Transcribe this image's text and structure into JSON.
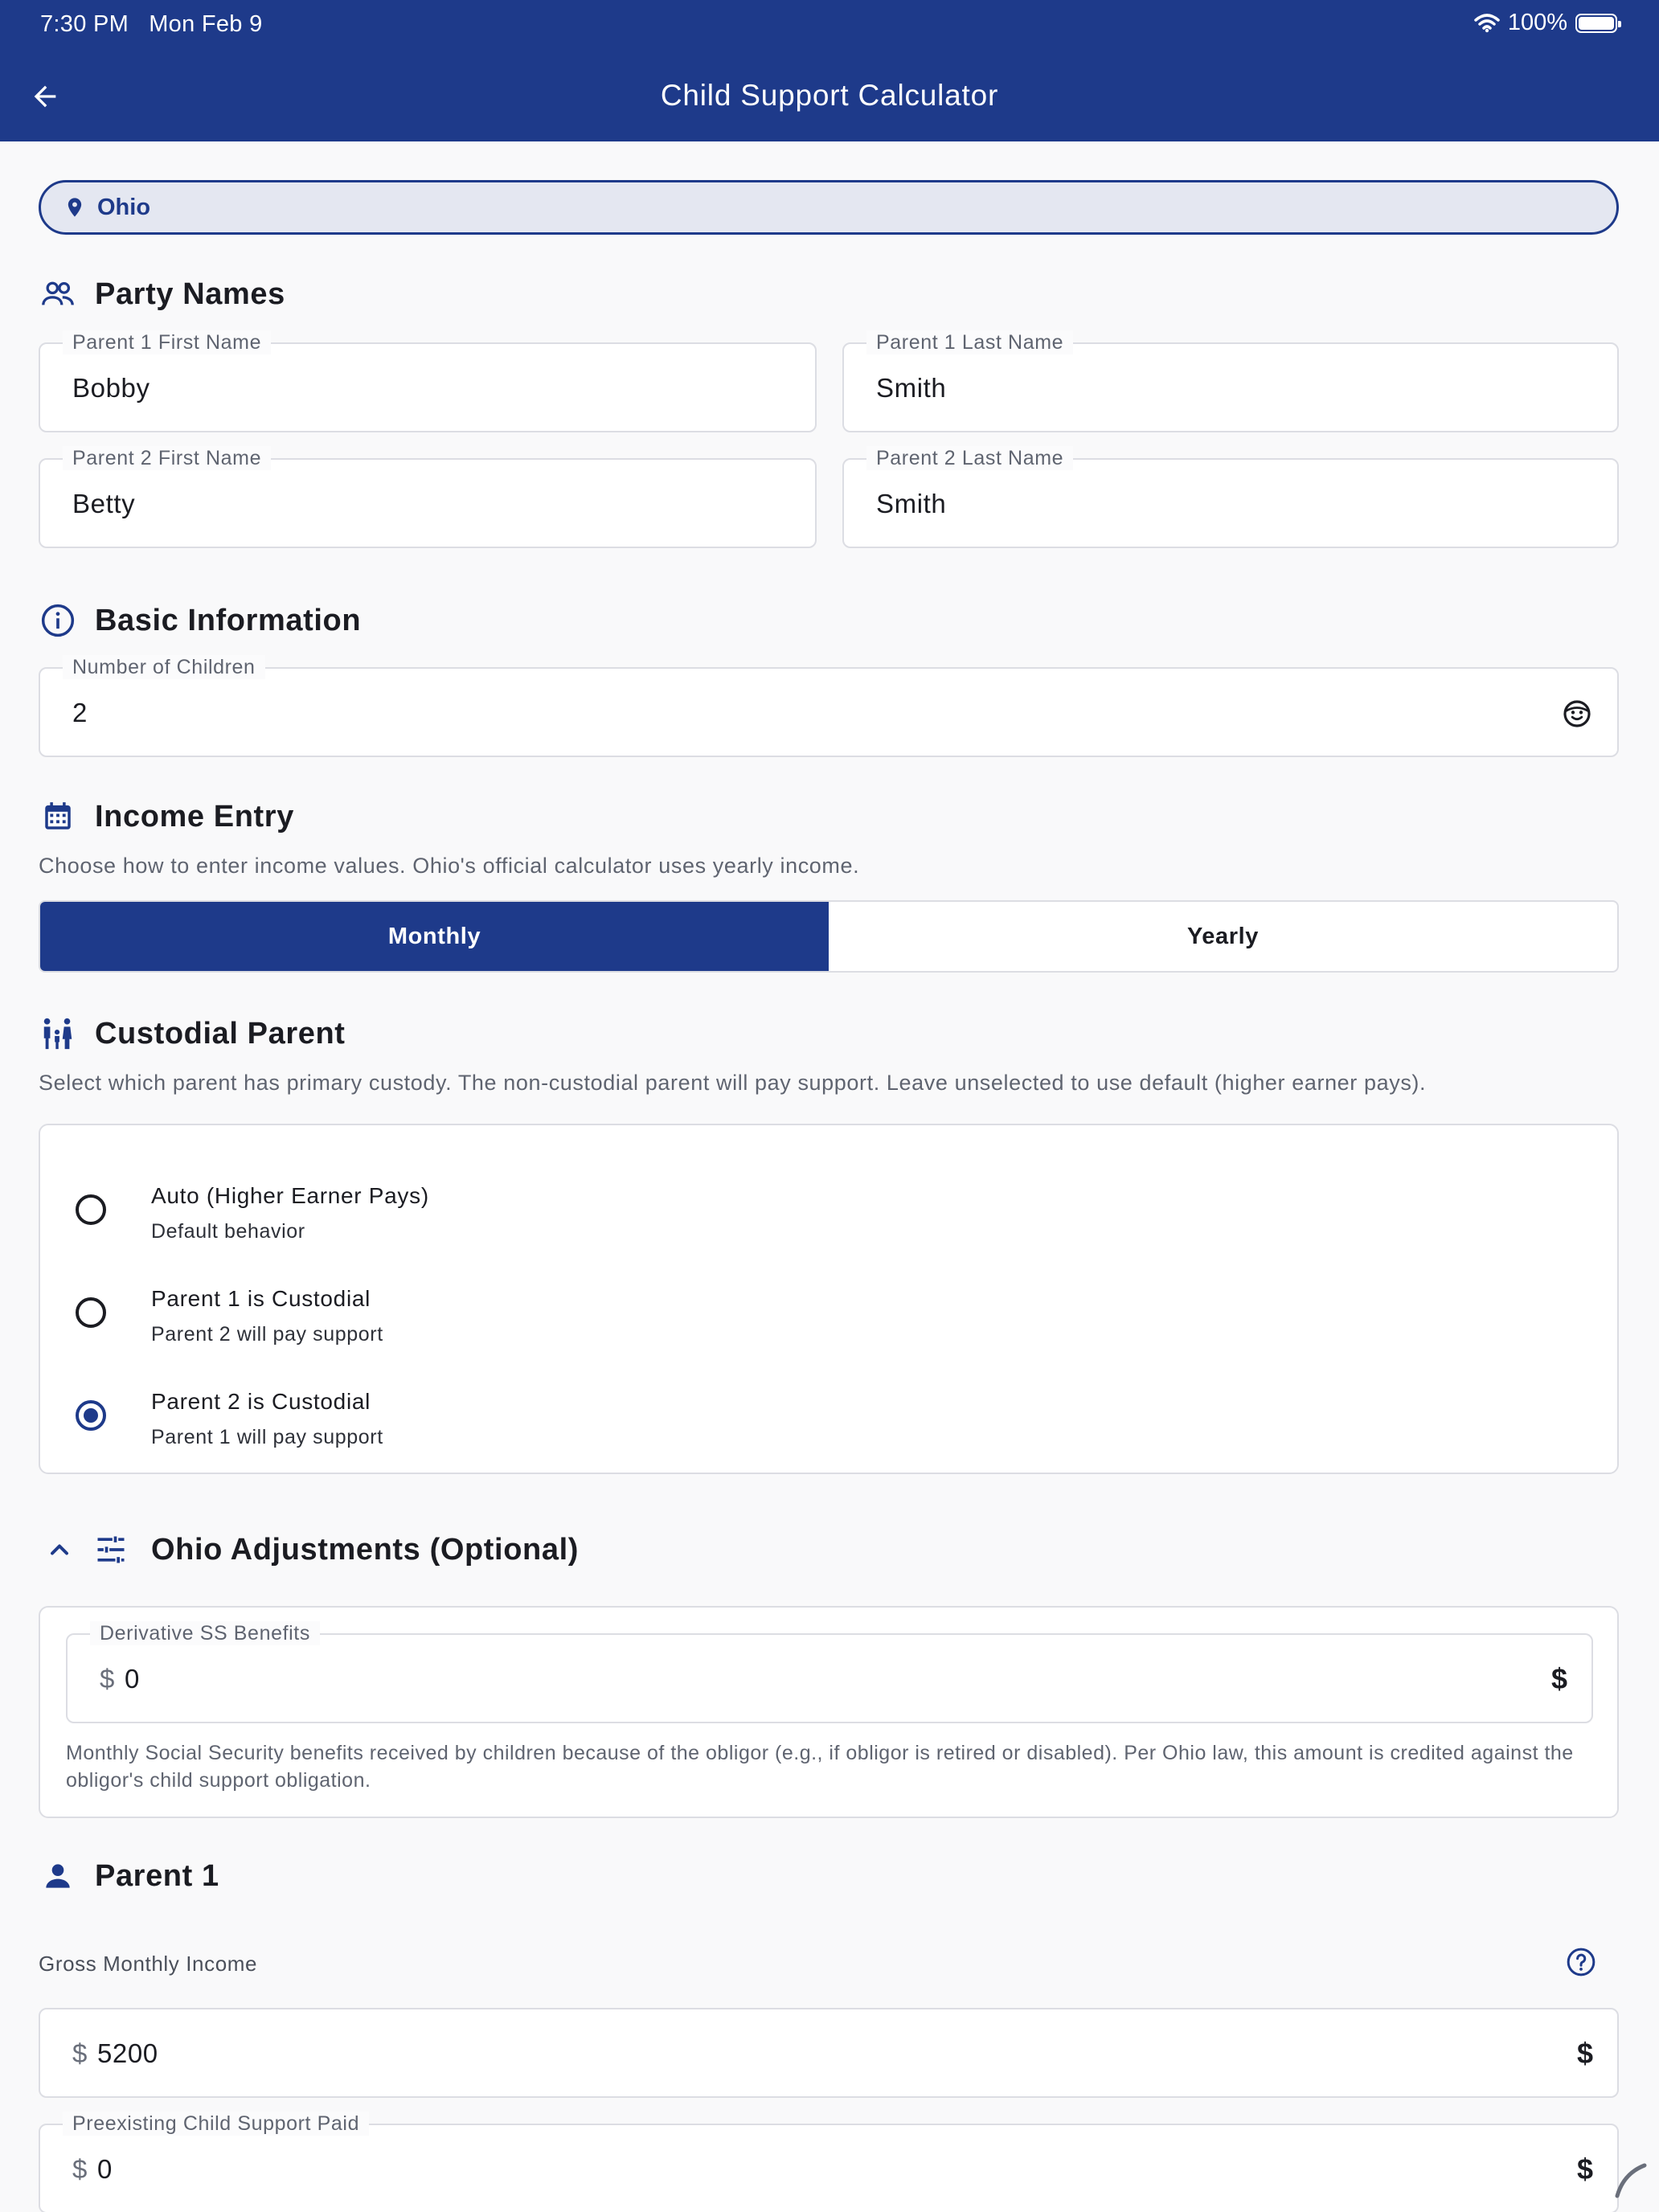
{
  "status_bar": {
    "time": "7:30 PM",
    "date": "Mon Feb 9",
    "battery": "100%"
  },
  "app_bar": {
    "title": "Child Support Calculator"
  },
  "state": {
    "label": "Ohio"
  },
  "party_names": {
    "title": "Party Names",
    "p1_first_label": "Parent 1 First Name",
    "p1_first": "Bobby",
    "p1_last_label": "Parent 1 Last Name",
    "p1_last": "Smith",
    "p2_first_label": "Parent 2 First Name",
    "p2_first": "Betty",
    "p2_last_label": "Parent 2 Last Name",
    "p2_last": "Smith"
  },
  "basic_info": {
    "title": "Basic Information",
    "children_label": "Number of Children",
    "children": "2"
  },
  "income_entry": {
    "title": "Income Entry",
    "helper": "Choose how to enter income values. Ohio's official calculator uses yearly income.",
    "options": [
      "Monthly",
      "Yearly"
    ],
    "selected": "Monthly"
  },
  "custodial": {
    "title": "Custodial Parent",
    "helper": "Select which parent has primary custody. The non-custodial parent will pay support. Leave unselected to use default (higher earner pays).",
    "options": [
      {
        "title": "Auto (Higher Earner Pays)",
        "sub": "Default behavior"
      },
      {
        "title": "Parent 1 is Custodial",
        "sub": "Parent 2 will pay support"
      },
      {
        "title": "Parent 2 is Custodial",
        "sub": "Parent 1 will pay support"
      }
    ],
    "selected_index": 2
  },
  "adjustments": {
    "title": "Ohio Adjustments (Optional)",
    "ss_label": "Derivative SS Benefits",
    "ss_prefix": "$",
    "ss_value": "0",
    "ss_trailing": "$",
    "ss_help": "Monthly Social Security benefits received by children because of the obligor (e.g., if obligor is retired or disabled). Per Ohio law, this amount is credited against the obligor's child support obligation."
  },
  "parent1": {
    "title": "Parent 1",
    "gross_label": "Gross Monthly Income",
    "gross_prefix": "$",
    "gross_value": "5200",
    "gross_trailing": "$",
    "preexisting_label": "Preexisting Child Support Paid",
    "preexisting_prefix": "$",
    "preexisting_value": "0",
    "preexisting_trailing": "$"
  },
  "colors": {
    "primary": "#1e3a8a",
    "background": "#f9f9fa",
    "chip_bg": "#e4e7f1",
    "border": "#dcdde3"
  },
  "icons": {
    "back": "arrow-left-icon",
    "location": "location-pin-icon",
    "people": "people-icon",
    "info": "info-icon",
    "calendar": "calendar-icon",
    "family": "family-icon",
    "chevron": "chevron-up-icon",
    "tune": "tune-icon",
    "person": "person-icon",
    "help": "help-circle-icon",
    "child": "child-face-icon"
  }
}
